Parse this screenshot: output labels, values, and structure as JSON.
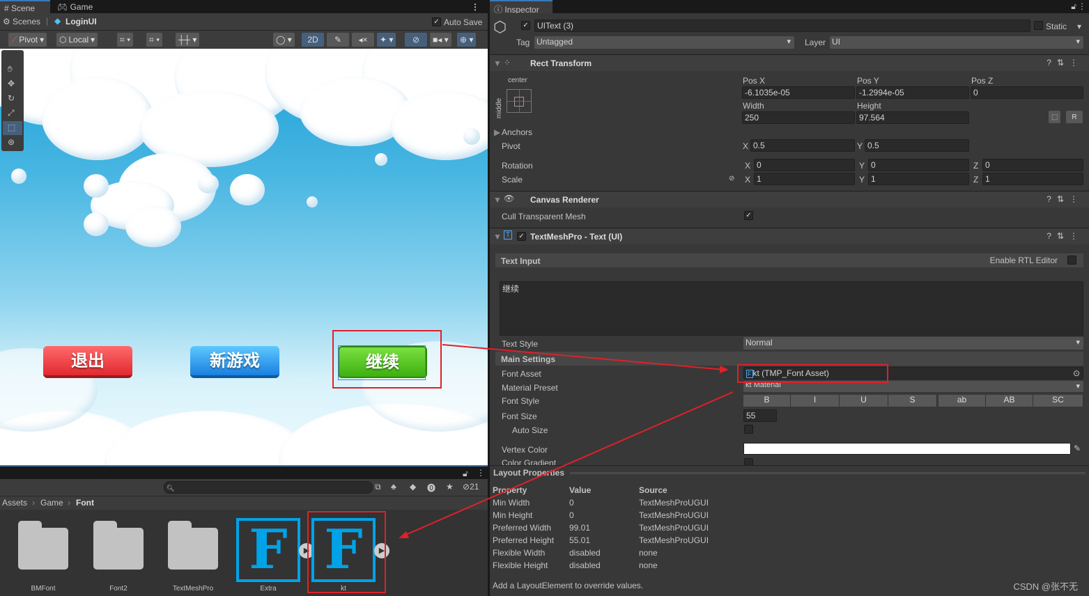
{
  "scene_panel": {
    "tabs": [
      {
        "label": "Scene",
        "icon": "grid-icon"
      },
      {
        "label": "Game",
        "icon": "gamepad-icon"
      }
    ],
    "scenes_label": "Scenes",
    "scene_name": "LoginUI",
    "auto_save_label": "Auto Save",
    "auto_save_checked": true,
    "toolbar": {
      "pivot": "Pivot",
      "local": "Local",
      "mode_2d": "2D"
    },
    "game_buttons": [
      {
        "label": "退出",
        "color": "#e8373c"
      },
      {
        "label": "新游戏",
        "color": "#1e8fe8"
      },
      {
        "label": "继续",
        "color": "#4cc61c"
      }
    ]
  },
  "project_panel": {
    "search_placeholder": "",
    "hidden_count": "21",
    "breadcrumb": [
      "Assets",
      "Game",
      "Font"
    ],
    "assets": [
      {
        "name": "BMFont",
        "type": "folder"
      },
      {
        "name": "Font2",
        "type": "folder"
      },
      {
        "name": "TextMeshPro",
        "type": "folder"
      },
      {
        "name": "Extra",
        "type": "font",
        "glyph": "F"
      },
      {
        "name": "kt",
        "type": "font",
        "glyph": "F"
      }
    ]
  },
  "inspector": {
    "tab": "Inspector",
    "object_name": "UIText (3)",
    "active": true,
    "static_label": "Static",
    "tag_label": "Tag",
    "tag": "Untagged",
    "layer_label": "Layer",
    "layer": "UI",
    "rect_transform": {
      "title": "Rect Transform",
      "anchor_h": "center",
      "anchor_v": "middle",
      "pos_x_label": "Pos X",
      "pos_y_label": "Pos Y",
      "pos_z_label": "Pos Z",
      "pos_x": "-6.1035e-05",
      "pos_y": "-1.2994e-05",
      "pos_z": "0",
      "width_label": "Width",
      "height_label": "Height",
      "width": "250",
      "height": "97.564",
      "r_button": "R",
      "anchors_label": "Anchors",
      "pivot_label": "Pivot",
      "pivot_x": "0.5",
      "pivot_y": "0.5",
      "rotation_label": "Rotation",
      "rot_x": "0",
      "rot_y": "0",
      "rot_z": "0",
      "scale_label": "Scale",
      "scale_x": "1",
      "scale_y": "1",
      "scale_z": "1",
      "x": "X",
      "y": "Y",
      "z": "Z"
    },
    "canvas_renderer": {
      "title": "Canvas Renderer",
      "cull_label": "Cull Transparent Mesh",
      "cull_checked": true
    },
    "tmp": {
      "title": "TextMeshPro - Text (UI)",
      "text_input_label": "Text Input",
      "rtl_label": "Enable RTL Editor",
      "text": "继续",
      "text_style_label": "Text Style",
      "text_style": "Normal",
      "main_settings": "Main Settings",
      "font_asset_label": "Font Asset",
      "font_asset": "kt (TMP_Font Asset)",
      "material_preset_label": "Material Preset",
      "material_preset": "kt Material",
      "font_style_label": "Font Style",
      "font_styles": [
        "B",
        "I",
        "U",
        "S",
        "ab",
        "AB",
        "SC"
      ],
      "font_size_label": "Font Size",
      "font_size": "55",
      "auto_size_label": "Auto Size",
      "vertex_color_label": "Vertex Color",
      "vertex_color": "#ffffff",
      "color_gradient_label": "Color Gradient"
    },
    "layout_properties": {
      "title": "Layout Properties",
      "headers": [
        "Property",
        "Value",
        "Source"
      ],
      "rows": [
        [
          "Min Width",
          "0",
          "TextMeshProUGUI"
        ],
        [
          "Min Height",
          "0",
          "TextMeshProUGUI"
        ],
        [
          "Preferred Width",
          "99.01",
          "TextMeshProUGUI"
        ],
        [
          "Preferred Height",
          "55.01",
          "TextMeshProUGUI"
        ],
        [
          "Flexible Width",
          "disabled",
          "none"
        ],
        [
          "Flexible Height",
          "disabled",
          "none"
        ]
      ],
      "footer": "Add a LayoutElement to override values."
    }
  },
  "watermark": "CSDN @张不无",
  "annotation_color": "#e0202a"
}
